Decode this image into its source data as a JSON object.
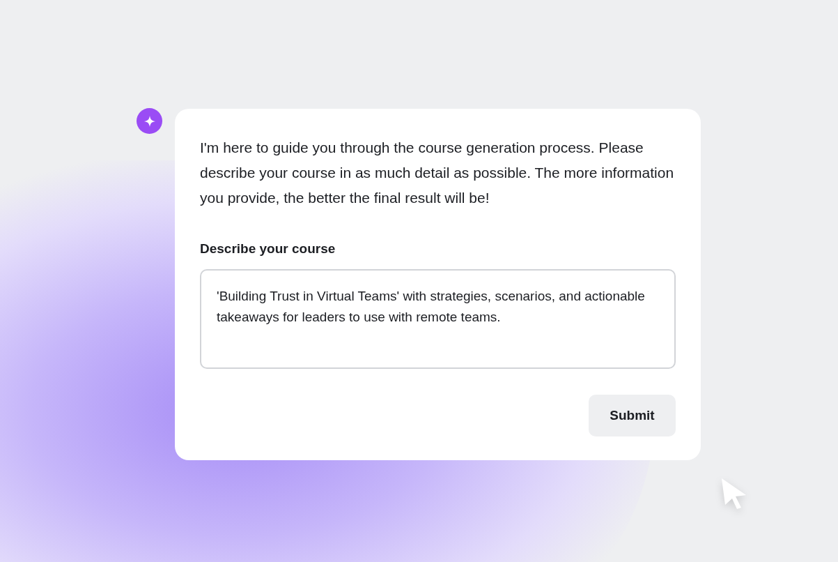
{
  "assistant_message": "I'm here to guide you through the course generation process. Please describe your course in as much detail as possible. The more information you provide, the better the final result will be!",
  "course_field": {
    "label": "Describe your course",
    "value": "'Building Trust in Virtual Teams' with strategies, scenarios, and actionable takeaways for leaders to use with remote teams."
  },
  "submit_button": {
    "label": "Submit"
  }
}
